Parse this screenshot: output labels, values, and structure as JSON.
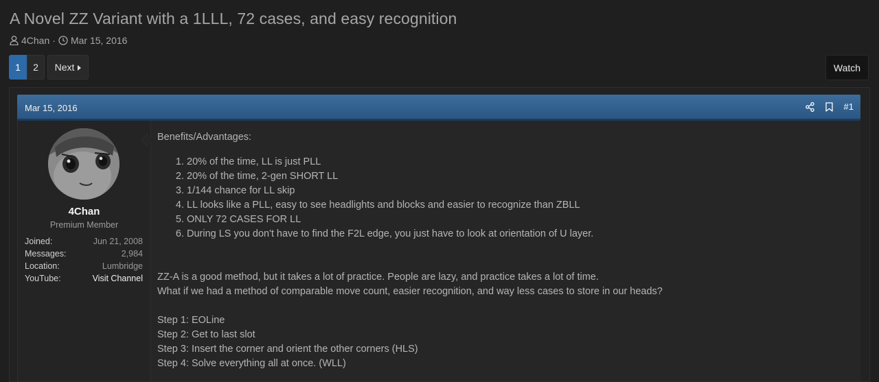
{
  "thread": {
    "title": "A Novel ZZ Variant with a 1LLL, 72 cases, and easy recognition",
    "author": "4Chan",
    "separator": "·",
    "date": "Mar 15, 2016"
  },
  "pagination": {
    "pages": [
      "1",
      "2"
    ],
    "current": "1",
    "next_label": "Next"
  },
  "watch_label": "Watch",
  "post": {
    "date": "Mar 15, 2016",
    "number": "#1",
    "user": {
      "name": "4Chan",
      "title": "Premium Member",
      "stats": [
        {
          "key": "Joined:",
          "value": "Jun 21, 2008"
        },
        {
          "key": "Messages:",
          "value": "2,984"
        },
        {
          "key": "Location:",
          "value": "Lumbridge"
        },
        {
          "key": "YouTube:",
          "value": "Visit Channel"
        }
      ]
    },
    "intro": "Benefits/Advantages:",
    "benefits": [
      "20% of the time, LL is just PLL",
      "20% of the time, 2-gen SHORT LL",
      "1/144 chance for LL skip",
      "LL looks like a PLL, easy to see headlights and blocks and easier to recognize than ZBLL",
      "ONLY 72 CASES FOR LL",
      "During LS you don't have to find the F2L edge, you just have to look at orientation of U layer."
    ],
    "paragraph1": "ZZ-A is a good method, but it takes a lot of practice. People are lazy, and practice takes a lot of time.",
    "paragraph2": "What if we had a method of comparable move count, easier recognition, and way less cases to store in our heads?",
    "steps": [
      "Step 1: EOLine",
      "Step 2: Get to last slot",
      "Step 3: Insert the corner and orient the other corners (HLS)",
      "Step 4: Solve everything all at once. (WLL)"
    ]
  },
  "colors": {
    "background": "#1f1f1f",
    "header_blue": "#2d6aa8",
    "text": "#b5b5b5"
  }
}
